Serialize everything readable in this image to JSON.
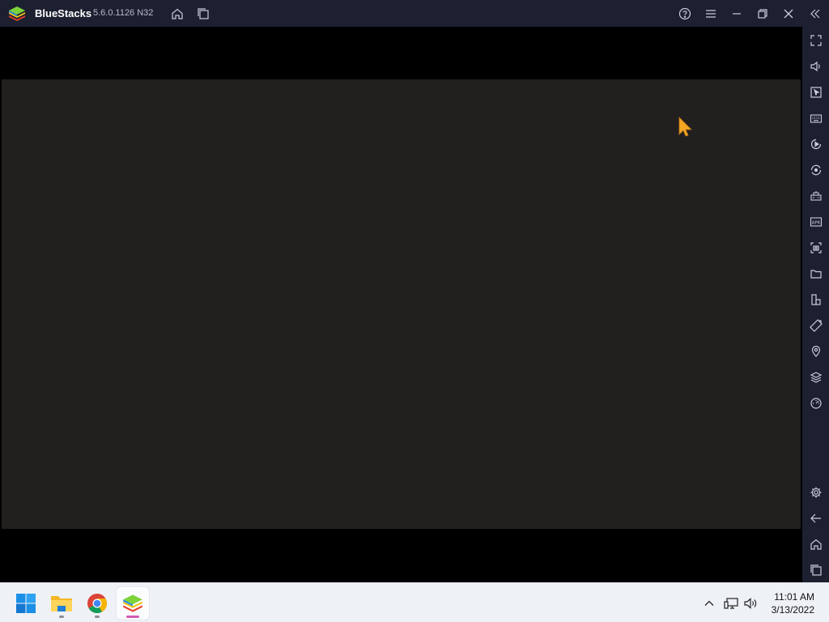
{
  "titlebar": {
    "app_name": "BlueStacks",
    "version": "5.6.0.1126 N32",
    "icons": [
      "home-icon",
      "multi-instance-icon",
      "help-icon",
      "menu-icon",
      "minimize-icon",
      "restore-icon",
      "close-icon",
      "collapse-sidebar-icon"
    ]
  },
  "sidebar": {
    "top_icons": [
      "fullscreen-icon",
      "volume-icon",
      "pointer-icon",
      "keyboard-icon",
      "macro-record-icon",
      "sync-icon",
      "game-controls-icon",
      "install-apk-icon",
      "screenshot-icon",
      "folder-icon",
      "multi-instance-manager-icon",
      "rotate-icon",
      "location-icon",
      "layers-icon",
      "performance-icon"
    ],
    "bottom_icons": [
      "settings-icon",
      "back-icon",
      "android-home-icon",
      "recent-apps-icon"
    ]
  },
  "taskbar": {
    "apps": [
      "start-icon",
      "file-explorer-icon",
      "chrome-icon",
      "bluestacks-icon"
    ],
    "tray_icons": [
      "show-hidden-icons-icon",
      "network-icon",
      "speaker-icon"
    ],
    "time": "11:01 AM",
    "date": "3/13/2022"
  },
  "colors": {
    "titlebar_bg": "#1d2031",
    "screen_bg": "#221f1f",
    "taskbar_bg": "#eef1f6",
    "active_indicator": "#d15bb3",
    "cursor": "#f5a623"
  }
}
